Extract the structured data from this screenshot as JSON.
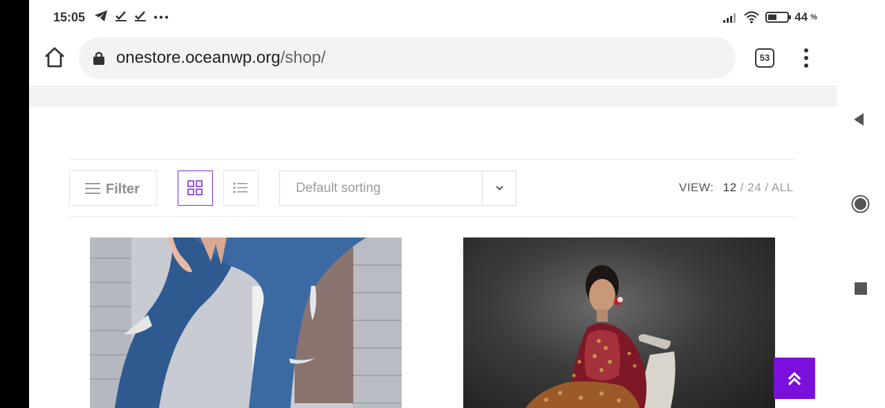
{
  "status_bar": {
    "time": "15:05",
    "left_icons": [
      "telegram-icon",
      "check-icon",
      "check-icon",
      "more-dots-icon"
    ],
    "battery_percent": "44",
    "percent_sign": "%",
    "battery_level": 0.44
  },
  "browser": {
    "url_domain": "onestore.oceanwp.org",
    "url_path": "/shop/",
    "tab_count": "53"
  },
  "shop_toolbar": {
    "filter_label": "Filter",
    "sort_selected": "Default sorting",
    "view_label": "VIEW:",
    "view_current": "12",
    "view_options": [
      "24",
      "ALL"
    ],
    "separator": "/"
  },
  "colors": {
    "accent": "#7b10dc",
    "grid_active_border": "#7c2ad6"
  },
  "products": [
    {
      "image": "ripped-jeans-photo"
    },
    {
      "image": "red-embroidered-dress-photo"
    }
  ]
}
